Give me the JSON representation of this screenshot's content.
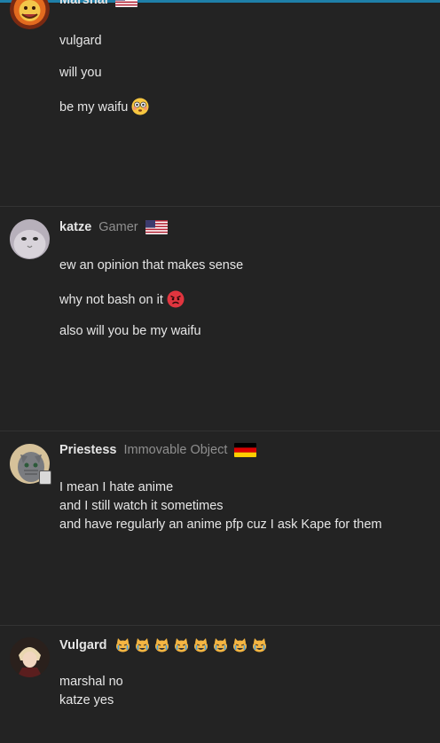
{
  "posts": [
    {
      "username": "Marshal",
      "role": "",
      "flag": "us",
      "lines": [
        "vulgard",
        "will you",
        "be my waifu"
      ],
      "emoji_after_line": "flushed-emoji"
    },
    {
      "username": "katze",
      "role": "Gamer",
      "flag": "us",
      "lines": [
        "ew an opinion that makes sense",
        "why not bash on it",
        "also will you be my waifu"
      ],
      "emoji_after_line": "angry-face-emoji"
    },
    {
      "username": "Priestess",
      "role": "Immovable Object",
      "flag": "de",
      "lines": [
        "I mean I hate anime",
        "and I still watch it sometimes",
        "and have regularly an anime pfp cuz I ask Kape for them"
      ]
    },
    {
      "username": "Vulgard",
      "role": "",
      "badge_emojis": [
        "crying-cat-emoji",
        "crying-cat-emoji",
        "crying-cat-emoji",
        "crying-cat-emoji",
        "crying-cat-emoji",
        "crying-cat-emoji",
        "crying-cat-emoji",
        "crying-cat-emoji"
      ],
      "lines": [
        "marshal no",
        "katze yes"
      ]
    }
  ],
  "colors": {
    "background": "#232323",
    "accent_bar": "#1e7fa8",
    "role_text": "#8f8f8f"
  }
}
